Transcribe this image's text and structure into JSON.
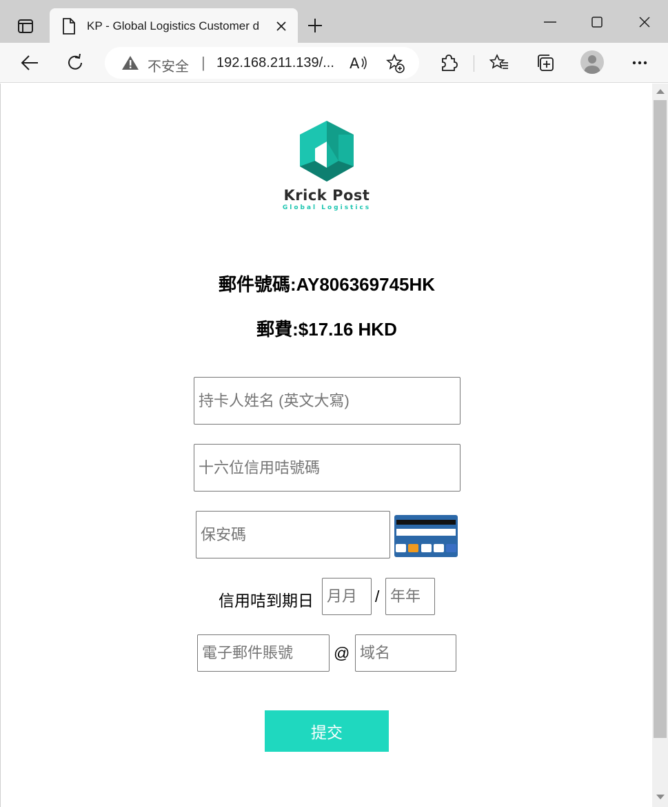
{
  "browser": {
    "tab_title": "KP - Global Logistics Customer d",
    "security_label": "不安全",
    "separator": "|",
    "url": "192.168.211.139/...",
    "read_aloud_glyph": "A"
  },
  "page": {
    "brand_name": "Krick Post",
    "brand_tagline": "Global Logistics",
    "tracking_line": "郵件號碼:AY806369745HK",
    "postage_line": "郵費:$17.16 HKD",
    "form": {
      "cardholder_placeholder": "持卡人姓名 (英文大寫)",
      "card_number_placeholder": "十六位信用咭號碼",
      "cvv_placeholder": "保安碼",
      "expiry_label": "信用咭到期日",
      "month_placeholder": "月月",
      "slash": "/",
      "year_placeholder": "年年",
      "email_user_placeholder": "電子郵件賬號",
      "at_sign": "@",
      "email_domain_placeholder": "域名",
      "submit_label": "提交"
    },
    "colors": {
      "accent": "#1fd8bf",
      "logo_dark": "#129e8a",
      "logo_light": "#1cc5b0"
    }
  }
}
